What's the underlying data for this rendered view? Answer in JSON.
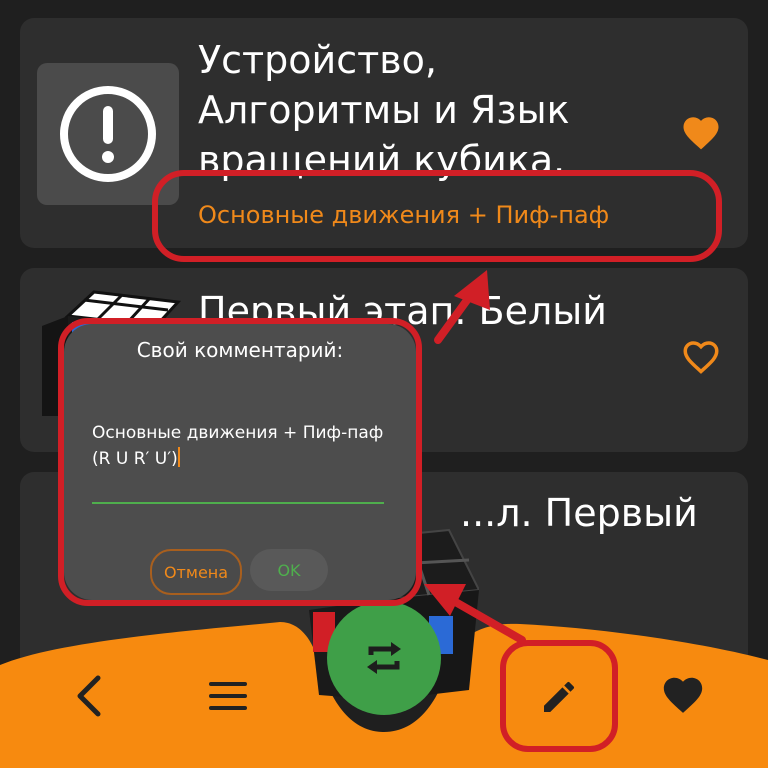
{
  "cards": [
    {
      "title": "Устройство,\nАлгоритмы и Язык\nвращений кубика.",
      "subtitle": "Основные движения + Пиф-паф",
      "favorite": true,
      "icon": "exclamation-icon"
    },
    {
      "title": "Первый этап. Белый",
      "favorite": false,
      "icon": "cube-thumbnail"
    },
    {
      "title": "...л. Первый",
      "icon": "cube-thumbnail"
    }
  ],
  "dialog": {
    "title": "Свой комментарий:",
    "value": "Основные движения + Пиф-паф (R U R′ U′)",
    "cancel_label": "Отмена",
    "ok_label": "OK"
  },
  "bottom_nav": {
    "back_icon": "chevron-left-icon",
    "menu_icon": "menu-icon",
    "center_icon": "repeat-icon",
    "edit_icon": "pencil-icon",
    "favorites_icon": "heart-icon"
  },
  "colors": {
    "accent": "#f0891a",
    "highlight": "#d11f26",
    "ok_green": "#4fae4d",
    "center_button": "#3f9f48"
  }
}
